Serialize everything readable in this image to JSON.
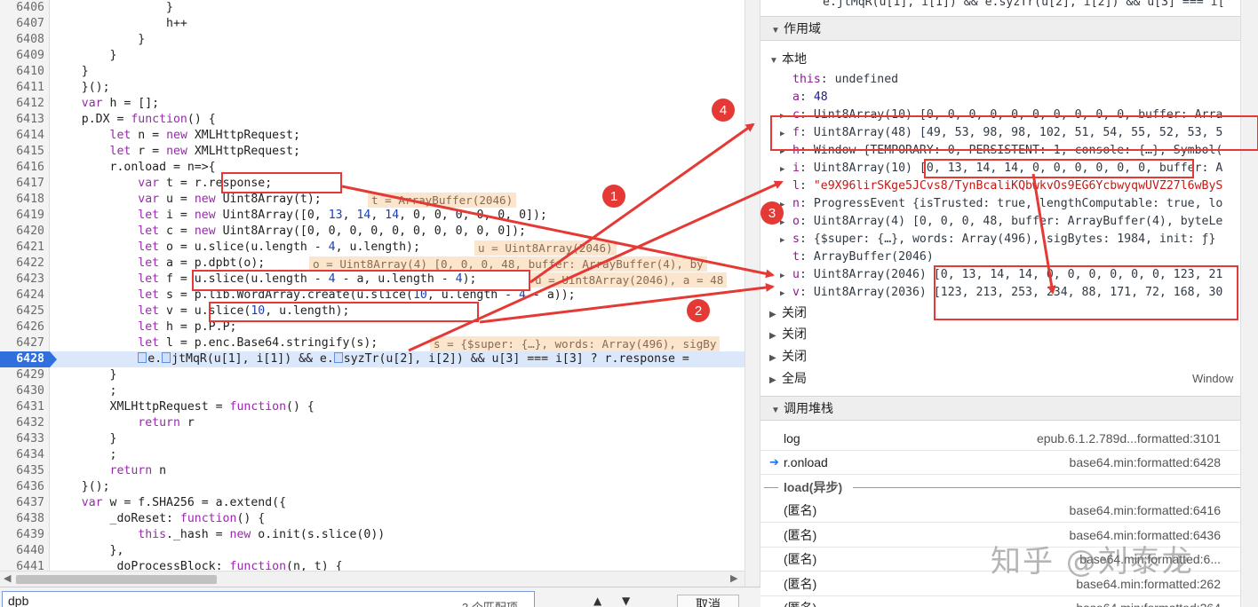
{
  "editor": {
    "lines": [
      {
        "num": "6406",
        "segs": [
          {
            "t": "                }"
          }
        ]
      },
      {
        "num": "6407",
        "segs": [
          {
            "t": "                h++"
          }
        ]
      },
      {
        "num": "6408",
        "segs": [
          {
            "t": "            }"
          }
        ]
      },
      {
        "num": "6409",
        "segs": [
          {
            "t": "        }"
          }
        ]
      },
      {
        "num": "6410",
        "segs": [
          {
            "t": "    }"
          }
        ]
      },
      {
        "num": "6411",
        "segs": [
          {
            "t": "    }();"
          }
        ]
      },
      {
        "num": "6412",
        "segs": [
          {
            "t": "    "
          },
          {
            "t": "var",
            "c": "kw"
          },
          {
            "t": " h = [];"
          }
        ]
      },
      {
        "num": "6413",
        "segs": [
          {
            "t": "    p.DX = "
          },
          {
            "t": "function",
            "c": "kw"
          },
          {
            "t": "() {"
          }
        ]
      },
      {
        "num": "6414",
        "segs": [
          {
            "t": "        "
          },
          {
            "t": "let",
            "c": "kw"
          },
          {
            "t": " n = "
          },
          {
            "t": "new",
            "c": "kw"
          },
          {
            "t": " XMLHttpRequest;"
          }
        ]
      },
      {
        "num": "6415",
        "segs": [
          {
            "t": "        "
          },
          {
            "t": "let",
            "c": "kw"
          },
          {
            "t": " r = "
          },
          {
            "t": "new",
            "c": "kw"
          },
          {
            "t": " XMLHttpRequest;"
          }
        ]
      },
      {
        "num": "6416",
        "segs": [
          {
            "t": "        r.onload = n=>{"
          }
        ]
      },
      {
        "num": "6417",
        "segs": [
          {
            "t": "            "
          },
          {
            "t": "var",
            "c": "kw"
          },
          {
            "t": " t = r.response;"
          }
        ]
      },
      {
        "num": "6418",
        "segs": [
          {
            "t": "            "
          },
          {
            "t": "var",
            "c": "kw"
          },
          {
            "t": " u = "
          },
          {
            "t": "new",
            "c": "kw"
          },
          {
            "t": " Uint8Array(t);"
          }
        ],
        "inline": "t = ArrayBuffer(2046)",
        "inlineX": 414
      },
      {
        "num": "6419",
        "segs": [
          {
            "t": "            "
          },
          {
            "t": "let",
            "c": "kw"
          },
          {
            "t": " i = "
          },
          {
            "t": "new",
            "c": "kw"
          },
          {
            "t": " Uint8Array([0, "
          },
          {
            "t": "13",
            "c": "n"
          },
          {
            "t": ", "
          },
          {
            "t": "14",
            "c": "n"
          },
          {
            "t": ", "
          },
          {
            "t": "14",
            "c": "n"
          },
          {
            "t": ", 0, 0, 0, 0, 0, 0]);"
          }
        ]
      },
      {
        "num": "6420",
        "segs": [
          {
            "t": "            "
          },
          {
            "t": "let",
            "c": "kw"
          },
          {
            "t": " c = "
          },
          {
            "t": "new",
            "c": "kw"
          },
          {
            "t": " Uint8Array([0, 0, 0, 0, 0, 0, 0, 0, 0, 0]);"
          }
        ]
      },
      {
        "num": "6421",
        "segs": [
          {
            "t": "            "
          },
          {
            "t": "let",
            "c": "kw"
          },
          {
            "t": " o = u.slice(u.length - "
          },
          {
            "t": "4",
            "c": "n"
          },
          {
            "t": ", u.length);"
          }
        ],
        "inline": "u = Uint8Array(2046)",
        "inlineX": 534
      },
      {
        "num": "6422",
        "segs": [
          {
            "t": "            "
          },
          {
            "t": "let",
            "c": "kw"
          },
          {
            "t": " a = p.dpbt(o);"
          }
        ],
        "inline": "o = Uint8Array(4) [0, 0, 0, 48, buffer: ArrayBuffer(4), by",
        "inlineX": 348
      },
      {
        "num": "6423",
        "segs": [
          {
            "t": "            "
          },
          {
            "t": "let",
            "c": "kw"
          },
          {
            "t": " f = u.slice(u.length - "
          },
          {
            "t": "4",
            "c": "n"
          },
          {
            "t": " - a, u.length - "
          },
          {
            "t": "4",
            "c": "n"
          },
          {
            "t": ");"
          }
        ],
        "inline": "u = Uint8Array(2046), a = 48",
        "inlineX": 598
      },
      {
        "num": "6424",
        "segs": [
          {
            "t": "            "
          },
          {
            "t": "let",
            "c": "kw"
          },
          {
            "t": " s = p.lib.WordArray.create(u.slice("
          },
          {
            "t": "10",
            "c": "n"
          },
          {
            "t": ", u.length - "
          },
          {
            "t": "4",
            "c": "n"
          },
          {
            "t": " - a));"
          }
        ]
      },
      {
        "num": "6425",
        "segs": [
          {
            "t": "            "
          },
          {
            "t": "let",
            "c": "kw"
          },
          {
            "t": " v = u.slice("
          },
          {
            "t": "10",
            "c": "n"
          },
          {
            "t": ", u.length);"
          }
        ]
      },
      {
        "num": "6426",
        "segs": [
          {
            "t": "            "
          },
          {
            "t": "let",
            "c": "kw"
          },
          {
            "t": " h = p.P.P;"
          }
        ]
      },
      {
        "num": "6427",
        "segs": [
          {
            "t": "            "
          },
          {
            "t": "let",
            "c": "kw"
          },
          {
            "t": " l = p.enc.Base64.stringify(s);"
          }
        ],
        "inline": "s = {$super: {…}, words: Array(496), sigBy",
        "inlineX": 484
      },
      {
        "num": "6428",
        "active": true,
        "segs": [
          {
            "t": "            "
          },
          {
            "t": "BP",
            "c": "bp"
          },
          {
            "t": "e."
          },
          {
            "t": "BP",
            "c": "bp"
          },
          {
            "t": "jtMqR(u[1], i[1]) && e."
          },
          {
            "t": "BP",
            "c": "bp"
          },
          {
            "t": "syzTr(u[2], i[2]) && u[3] === i[3] ? r.response = "
          }
        ]
      },
      {
        "num": "6429",
        "segs": [
          {
            "t": "        }"
          }
        ]
      },
      {
        "num": "6430",
        "segs": [
          {
            "t": "        ;"
          }
        ]
      },
      {
        "num": "6431",
        "segs": [
          {
            "t": "        XMLHttpRequest = "
          },
          {
            "t": "function",
            "c": "kw"
          },
          {
            "t": "() {"
          }
        ]
      },
      {
        "num": "6432",
        "segs": [
          {
            "t": "            "
          },
          {
            "t": "return",
            "c": "kw"
          },
          {
            "t": " r"
          }
        ]
      },
      {
        "num": "6433",
        "segs": [
          {
            "t": "        }"
          }
        ]
      },
      {
        "num": "6434",
        "segs": [
          {
            "t": "        ;"
          }
        ]
      },
      {
        "num": "6435",
        "segs": [
          {
            "t": "        "
          },
          {
            "t": "return",
            "c": "kw"
          },
          {
            "t": " n"
          }
        ]
      },
      {
        "num": "6436",
        "segs": [
          {
            "t": "    }();"
          }
        ]
      },
      {
        "num": "6437",
        "segs": [
          {
            "t": "    "
          },
          {
            "t": "var",
            "c": "kw"
          },
          {
            "t": " w = f.SHA256 = a.extend({"
          }
        ]
      },
      {
        "num": "6438",
        "segs": [
          {
            "t": "        _doReset: "
          },
          {
            "t": "function",
            "c": "kw"
          },
          {
            "t": "() {"
          }
        ]
      },
      {
        "num": "6439",
        "segs": [
          {
            "t": "            "
          },
          {
            "t": "this",
            "c": "kw"
          },
          {
            "t": "._hash = "
          },
          {
            "t": "new",
            "c": "kw"
          },
          {
            "t": " o.init(s.slice(0))"
          }
        ]
      },
      {
        "num": "6440",
        "segs": [
          {
            "t": "        },"
          }
        ]
      },
      {
        "num": "6441",
        "segs": [
          {
            "t": "        _doProcessBlock: "
          },
          {
            "t": "function",
            "c": "kw"
          },
          {
            "t": "(n, t) {"
          }
        ]
      }
    ]
  },
  "search": {
    "value": "dpb",
    "match_count": "3 个匹配项",
    "cancel_label": "取消",
    "up_arrow": "▲",
    "down_arrow": "▼"
  },
  "scope": {
    "top_clip": "e.jtMqR(u[1], i[1]) && e.syzTr(u[2], i[2]) && u[3] === i[",
    "header": "作用域",
    "local_label": "本地",
    "props": [
      {
        "expand": false,
        "name": "this",
        "val": "undefined",
        "cls": "pgrey"
      },
      {
        "expand": false,
        "name": "a",
        "val": "48",
        "cls": "pval"
      },
      {
        "expand": true,
        "name": "c",
        "val": "Uint8Array(10) [0, 0, 0, 0, 0, 0, 0, 0, 0, 0, buffer: Arra",
        "cls": "pgrey"
      },
      {
        "expand": true,
        "name": "f",
        "val": "Uint8Array(48) [49, 53, 98, 98, 102, 51, 54, 55, 52, 53, 5",
        "cls": "pgrey"
      },
      {
        "expand": true,
        "name": "h",
        "val": "Window {TEMPORARY: 0, PERSISTENT: 1, console: {…}, Symbol(",
        "cls": "pgrey"
      },
      {
        "expand": true,
        "name": "i",
        "val": "Uint8Array(10) [0, 13, 14, 14, 0, 0, 0, 0, 0, 0, buffer: A",
        "cls": "pgrey"
      },
      {
        "expand": false,
        "name": "l",
        "val": "\"e9X96lirSKge5JCvs8/TynBcaliKQbwkvOs9EG6YcbwyqwUVZ27l6wByS",
        "cls": "pstr"
      },
      {
        "expand": true,
        "name": "n",
        "val": "ProgressEvent {isTrusted: true, lengthComputable: true, lo",
        "cls": "pgrey"
      },
      {
        "expand": true,
        "name": "o",
        "val": "Uint8Array(4) [0, 0, 0, 48, buffer: ArrayBuffer(4), byteLe",
        "cls": "pgrey"
      },
      {
        "expand": true,
        "name": "s",
        "val": "{$super: {…}, words: Array(496), sigBytes: 1984, init: ƒ}",
        "cls": "pgrey"
      },
      {
        "expand": false,
        "name": "t",
        "val": "ArrayBuffer(2046)",
        "cls": "pgrey"
      },
      {
        "expand": true,
        "name": "u",
        "val": "Uint8Array(2046) [0, 13, 14, 14, 0, 0, 0, 0, 0, 0, 123, 21",
        "cls": "pgrey"
      },
      {
        "expand": true,
        "name": "v",
        "val": "Uint8Array(2036) [123, 213, 253, 234, 88, 171, 72, 168, 30",
        "cls": "pgrey"
      }
    ],
    "closures": [
      "关闭",
      "关闭",
      "关闭"
    ],
    "global_label": "全局",
    "global_value": "Window"
  },
  "callstack": {
    "header": "调用堆栈",
    "frames": [
      {
        "fn": "log",
        "loc": "epub.6.1.2.789d...formatted:3101",
        "current": false
      },
      {
        "fn": "r.onload",
        "loc": "base64.min:formatted:6428",
        "current": true
      }
    ],
    "async_label": "load(异步)",
    "async_frames": [
      {
        "fn": "(匿名)",
        "loc": "base64.min:formatted:6416"
      },
      {
        "fn": "(匿名)",
        "loc": "base64.min:formatted:6436"
      },
      {
        "fn": "(匿名)",
        "loc": "base64.min:formatted:6..."
      },
      {
        "fn": "(匿名)",
        "loc": "base64.min:formatted:262"
      },
      {
        "fn": "(匿名)",
        "loc": "base64.min:formatted:264"
      }
    ],
    "current_marker": "➔"
  },
  "annotations": {
    "markers": [
      "1",
      "2",
      "3",
      "4"
    ],
    "watermark": "知乎 @刘泰龙",
    "accent": "#e53935"
  },
  "icons": {
    "expand_open": "▼",
    "expand_closed": "▶",
    "left_arrow": "◀",
    "right_arrow": "▶"
  }
}
